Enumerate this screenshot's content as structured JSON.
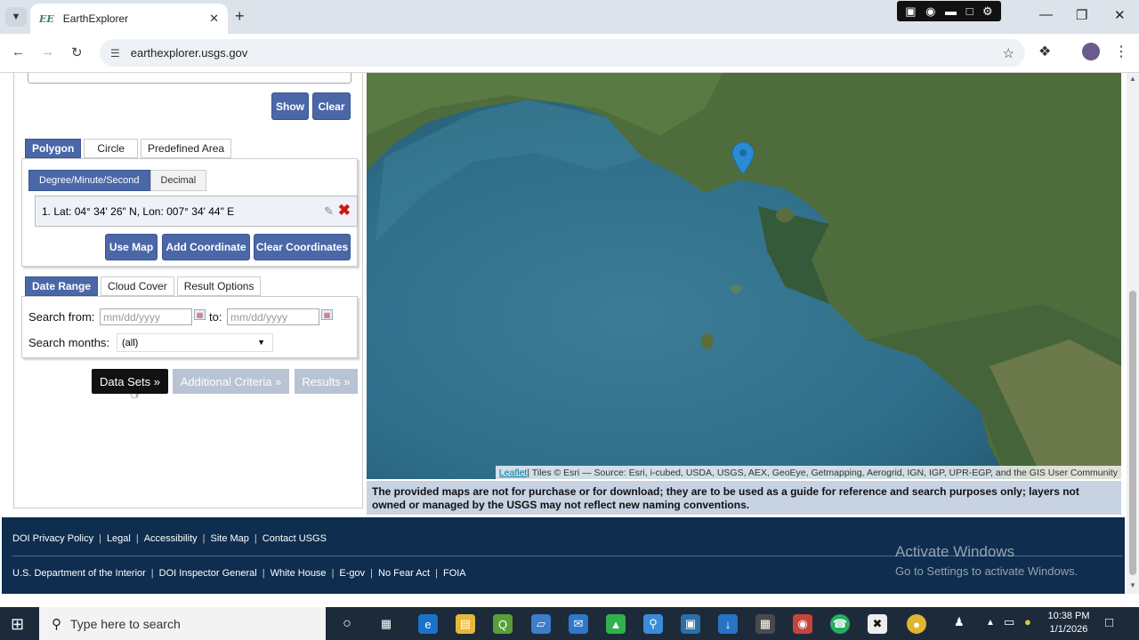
{
  "browser": {
    "tab_title": "EarthExplorer",
    "favicon_text": "EE",
    "url": "earthexplorer.usgs.gov"
  },
  "search_area": {
    "show_label": "Show",
    "clear_label": "Clear",
    "shape_tabs": [
      "Polygon",
      "Circle",
      "Predefined Area"
    ],
    "format_tabs": [
      "Degree/Minute/Second",
      "Decimal"
    ],
    "coordinate": "1.  Lat: 04° 34' 26\" N, Lon: 007° 34' 44\" E",
    "use_map_label": "Use Map",
    "add_coordinate_label": "Add Coordinate",
    "clear_coordinates_label": "Clear Coordinates"
  },
  "date_section": {
    "tabs": [
      "Date Range",
      "Cloud Cover",
      "Result Options"
    ],
    "search_from_label": "Search from:",
    "to_label": "to:",
    "date_placeholder": "mm/dd/yyyy",
    "search_months_label": "Search months:",
    "months_value": "(all)"
  },
  "steps": {
    "data_sets": "Data Sets »",
    "additional_criteria": "Additional Criteria »",
    "results": "Results »"
  },
  "map": {
    "attribution_link": "Leaflet",
    "attribution_text": " | Tiles © Esri — Source: Esri, i-cubed, USDA, USGS, AEX, GeoEye, Getmapping, Aerogrid, IGN, IGP, UPR-EGP, and the GIS User Community",
    "disclaimer": "The provided maps are not for purchase or for download; they are to be used as a guide for reference and search purposes only; layers not owned or managed by the USGS may not reflect new naming conventions."
  },
  "footer": {
    "row1": [
      "DOI Privacy Policy",
      "Legal",
      "Accessibility",
      "Site Map",
      "Contact USGS"
    ],
    "row2": [
      "U.S. Department of the Interior",
      "DOI Inspector General",
      "White House",
      "E-gov",
      "No Fear Act",
      "FOIA"
    ],
    "activate_title": "Activate Windows",
    "activate_sub": "Go to Settings to activate Windows."
  },
  "taskbar": {
    "search_placeholder": "Type here to search",
    "time": "10:38 PM",
    "date": "1/1/2026"
  },
  "colors": {
    "accent": "#4a67a8",
    "footer_bg": "#0e2d4f",
    "disclaimer_bg": "#c7d3e3",
    "map_marker": "#2a8ad4"
  }
}
